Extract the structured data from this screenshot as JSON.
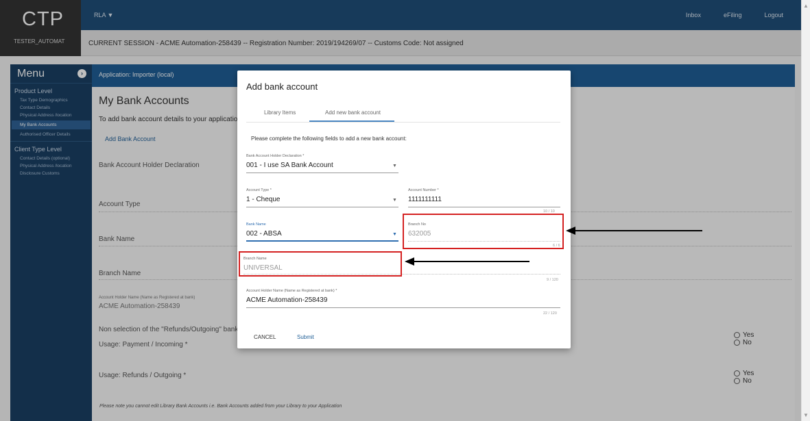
{
  "header": {
    "logo": "CTP",
    "user": "TESTER_AUTOMAT",
    "rla_menu": "RLA ▼",
    "links": [
      "Inbox",
      "eFiling",
      "Logout"
    ]
  },
  "session": {
    "text": "CURRENT SESSION - ACME Automation-258439 -- Registration Number: 2019/194269/07 -- Customs Code: Not assigned"
  },
  "sidebar": {
    "title": "Menu",
    "sections": [
      {
        "label": "Product Level",
        "items": [
          "Tax Type Demographics",
          "Contact Details",
          "Physical Address /location",
          "My Bank Accounts",
          "Authorised Officer Details"
        ]
      },
      {
        "label": "Client Type Level",
        "items": [
          "Contact Details (optional)",
          "Physical Address /location",
          "Disclosure Customs"
        ]
      }
    ],
    "active_item": "My Bank Accounts"
  },
  "main": {
    "application": "Application: Importer (local)",
    "title": "My Bank Accounts",
    "description": "To add bank account details to your application",
    "add_link": "Add Bank Account",
    "fields": {
      "holder_declaration": "Bank Account Holder Declaration",
      "account_type": "Account Type",
      "bank_name": "Bank Name",
      "branch_name": "Branch Name",
      "account_holder_label": "Account Holder Name (Name as Registered at bank)",
      "account_holder_value": "ACME Automation-258439",
      "non_selection": "Non selection of the \"Refunds/Outgoing\" bank a",
      "usage_payment": "Usage: Payment / Incoming *",
      "usage_refunds": "Usage: Refunds / Outgoing *"
    },
    "radio_yes": "Yes",
    "radio_no": "No",
    "note": "Please note  you cannot edit Library Bank Accounts i.e. Bank Accounts added from your Library to your Application"
  },
  "modal": {
    "title": "Add bank account",
    "tabs": [
      "Library Items",
      "Add new bank account"
    ],
    "active_tab": "Add new bank account",
    "instructions": "Please complete the following fields to add a new bank account:",
    "holder_declaration_label": "Bank Account Holder Declaration *",
    "holder_declaration_value": "001 - I use SA Bank Account",
    "account_type_label": "Account Type *",
    "account_type_value": "1 - Cheque",
    "account_number_label": "Account Number *",
    "account_number_value": "1111111111",
    "account_number_counter": "10 / 10",
    "bank_name_label": "Bank Name",
    "bank_name_value": "002 - ABSA",
    "branch_no_label": "Branch No",
    "branch_no_value": "632005",
    "branch_no_counter": "6 / 6",
    "branch_name_label": "Branch Name",
    "branch_name_value": "UNIVERSAL",
    "branch_name_counter": "9 / 120",
    "holder_name_label": "Account Holder Name (Name as Registered at bank) *",
    "holder_name_value": "ACME Automation-258439",
    "holder_name_counter": "22 / 120",
    "cancel": "CANCEL",
    "submit": "Submit"
  },
  "annotation_color": "#d42020"
}
